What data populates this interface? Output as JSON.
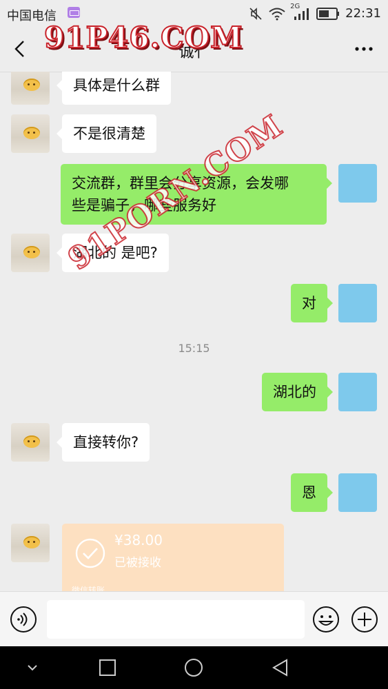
{
  "status_bar": {
    "carrier": "中国电信",
    "network": "2G",
    "time": "22:31",
    "icons": [
      "keyboard-icon",
      "mute-icon",
      "wifi-icon",
      "signal-icon",
      "battery-icon"
    ]
  },
  "header": {
    "title": "诚⺅",
    "back_icon": "chevron-left-icon",
    "more_icon": "more-horizontal-icon"
  },
  "messages": [
    {
      "side": "in",
      "text": "具体是什么群"
    },
    {
      "side": "in",
      "text": "不是很清楚"
    },
    {
      "side": "out",
      "line1": "交流群，群里会分享资源，会发哪",
      "line2": "些是骗子，哪些服务好"
    },
    {
      "side": "in",
      "text": "湖北的 是吧?"
    },
    {
      "side": "out",
      "text": "对"
    },
    {
      "side": "out",
      "text": "湖北的"
    },
    {
      "side": "in",
      "text": "直接转你?"
    },
    {
      "side": "out",
      "text": "恩"
    }
  ],
  "timestamp": "15:15",
  "transfer": {
    "amount": "¥38.00",
    "status": "已被接收",
    "footer": "微信转账"
  },
  "input_bar": {
    "placeholder": "",
    "icons": [
      "voice-icon",
      "emoji-icon",
      "plus-icon"
    ]
  },
  "watermarks": {
    "top": "91P46.COM",
    "diagonal": "91PORN.COM"
  },
  "colors": {
    "background": "#ededed",
    "bubble_in": "#ffffff",
    "bubble_out": "#95ec69",
    "transfer_card": "#fde0c1",
    "avatar_self": "#7ec9ec"
  }
}
